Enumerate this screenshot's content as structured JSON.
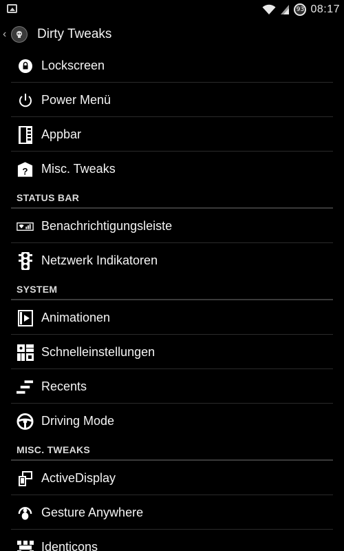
{
  "statusbar": {
    "battery_level": "93",
    "time": "08:17",
    "icons": [
      "image-notification-icon",
      "wifi-icon",
      "signal-icon",
      "battery-icon"
    ]
  },
  "actionbar": {
    "title": "Dirty Tweaks"
  },
  "colors": {
    "background": "#000000",
    "text": "#f4f4f4",
    "section_header": "#dcdcdc",
    "divider": "#2b2b2b"
  },
  "items": {
    "lockscreen": {
      "label": "Lockscreen",
      "icon": "lock-icon"
    },
    "power_menu": {
      "label": "Power Menü",
      "icon": "power-icon"
    },
    "appbar": {
      "label": "Appbar",
      "icon": "appbar-icon"
    },
    "misc_tweaks": {
      "label": "Misc. Tweaks",
      "icon": "question-house-icon"
    },
    "notification_bar": {
      "label": "Benachrichtigungsleiste",
      "icon": "statusbar-icon"
    },
    "network_indicators": {
      "label": "Netzwerk Indikatoren",
      "icon": "traffic-light-icon"
    },
    "animations": {
      "label": "Animationen",
      "icon": "animation-icon"
    },
    "quick_settings": {
      "label": "Schnelleinstellungen",
      "icon": "quick-settings-icon"
    },
    "recents": {
      "label": "Recents",
      "icon": "recents-icon"
    },
    "driving_mode": {
      "label": "Driving Mode",
      "icon": "steering-wheel-icon"
    },
    "active_display": {
      "label": "ActiveDisplay",
      "icon": "active-display-icon"
    },
    "gesture_anywhere": {
      "label": "Gesture Anywhere",
      "icon": "gesture-icon"
    },
    "identicons": {
      "label": "Identicons",
      "icon": "identicon-icon"
    }
  },
  "sections": {
    "status_bar": "STATUS BAR",
    "system": "SYSTEM",
    "misc_tweaks": "MISC. TWEAKS"
  }
}
